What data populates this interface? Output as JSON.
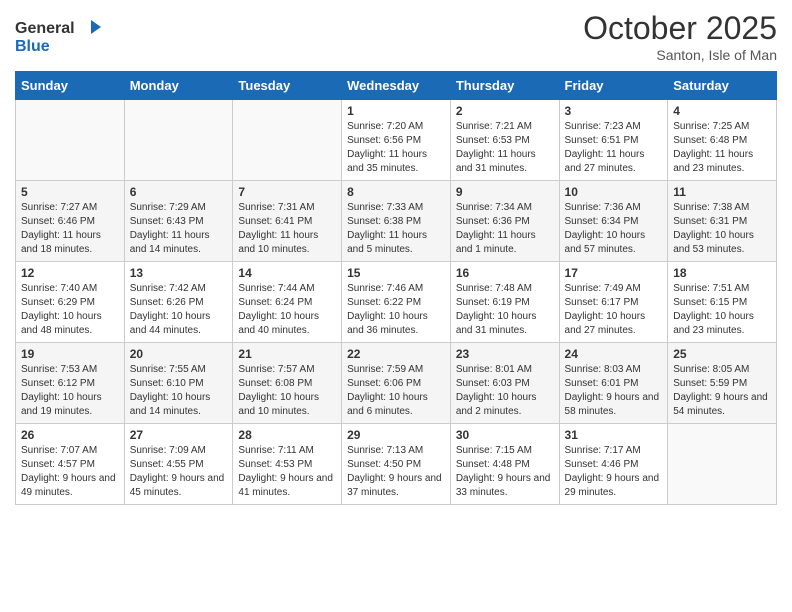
{
  "header": {
    "logo_line1": "General",
    "logo_line2": "Blue",
    "month": "October 2025",
    "location": "Santon, Isle of Man"
  },
  "days_of_week": [
    "Sunday",
    "Monday",
    "Tuesday",
    "Wednesday",
    "Thursday",
    "Friday",
    "Saturday"
  ],
  "weeks": [
    [
      {
        "day": "",
        "info": ""
      },
      {
        "day": "",
        "info": ""
      },
      {
        "day": "",
        "info": ""
      },
      {
        "day": "1",
        "info": "Sunrise: 7:20 AM\nSunset: 6:56 PM\nDaylight: 11 hours and 35 minutes."
      },
      {
        "day": "2",
        "info": "Sunrise: 7:21 AM\nSunset: 6:53 PM\nDaylight: 11 hours and 31 minutes."
      },
      {
        "day": "3",
        "info": "Sunrise: 7:23 AM\nSunset: 6:51 PM\nDaylight: 11 hours and 27 minutes."
      },
      {
        "day": "4",
        "info": "Sunrise: 7:25 AM\nSunset: 6:48 PM\nDaylight: 11 hours and 23 minutes."
      }
    ],
    [
      {
        "day": "5",
        "info": "Sunrise: 7:27 AM\nSunset: 6:46 PM\nDaylight: 11 hours and 18 minutes."
      },
      {
        "day": "6",
        "info": "Sunrise: 7:29 AM\nSunset: 6:43 PM\nDaylight: 11 hours and 14 minutes."
      },
      {
        "day": "7",
        "info": "Sunrise: 7:31 AM\nSunset: 6:41 PM\nDaylight: 11 hours and 10 minutes."
      },
      {
        "day": "8",
        "info": "Sunrise: 7:33 AM\nSunset: 6:38 PM\nDaylight: 11 hours and 5 minutes."
      },
      {
        "day": "9",
        "info": "Sunrise: 7:34 AM\nSunset: 6:36 PM\nDaylight: 11 hours and 1 minute."
      },
      {
        "day": "10",
        "info": "Sunrise: 7:36 AM\nSunset: 6:34 PM\nDaylight: 10 hours and 57 minutes."
      },
      {
        "day": "11",
        "info": "Sunrise: 7:38 AM\nSunset: 6:31 PM\nDaylight: 10 hours and 53 minutes."
      }
    ],
    [
      {
        "day": "12",
        "info": "Sunrise: 7:40 AM\nSunset: 6:29 PM\nDaylight: 10 hours and 48 minutes."
      },
      {
        "day": "13",
        "info": "Sunrise: 7:42 AM\nSunset: 6:26 PM\nDaylight: 10 hours and 44 minutes."
      },
      {
        "day": "14",
        "info": "Sunrise: 7:44 AM\nSunset: 6:24 PM\nDaylight: 10 hours and 40 minutes."
      },
      {
        "day": "15",
        "info": "Sunrise: 7:46 AM\nSunset: 6:22 PM\nDaylight: 10 hours and 36 minutes."
      },
      {
        "day": "16",
        "info": "Sunrise: 7:48 AM\nSunset: 6:19 PM\nDaylight: 10 hours and 31 minutes."
      },
      {
        "day": "17",
        "info": "Sunrise: 7:49 AM\nSunset: 6:17 PM\nDaylight: 10 hours and 27 minutes."
      },
      {
        "day": "18",
        "info": "Sunrise: 7:51 AM\nSunset: 6:15 PM\nDaylight: 10 hours and 23 minutes."
      }
    ],
    [
      {
        "day": "19",
        "info": "Sunrise: 7:53 AM\nSunset: 6:12 PM\nDaylight: 10 hours and 19 minutes."
      },
      {
        "day": "20",
        "info": "Sunrise: 7:55 AM\nSunset: 6:10 PM\nDaylight: 10 hours and 14 minutes."
      },
      {
        "day": "21",
        "info": "Sunrise: 7:57 AM\nSunset: 6:08 PM\nDaylight: 10 hours and 10 minutes."
      },
      {
        "day": "22",
        "info": "Sunrise: 7:59 AM\nSunset: 6:06 PM\nDaylight: 10 hours and 6 minutes."
      },
      {
        "day": "23",
        "info": "Sunrise: 8:01 AM\nSunset: 6:03 PM\nDaylight: 10 hours and 2 minutes."
      },
      {
        "day": "24",
        "info": "Sunrise: 8:03 AM\nSunset: 6:01 PM\nDaylight: 9 hours and 58 minutes."
      },
      {
        "day": "25",
        "info": "Sunrise: 8:05 AM\nSunset: 5:59 PM\nDaylight: 9 hours and 54 minutes."
      }
    ],
    [
      {
        "day": "26",
        "info": "Sunrise: 7:07 AM\nSunset: 4:57 PM\nDaylight: 9 hours and 49 minutes."
      },
      {
        "day": "27",
        "info": "Sunrise: 7:09 AM\nSunset: 4:55 PM\nDaylight: 9 hours and 45 minutes."
      },
      {
        "day": "28",
        "info": "Sunrise: 7:11 AM\nSunset: 4:53 PM\nDaylight: 9 hours and 41 minutes."
      },
      {
        "day": "29",
        "info": "Sunrise: 7:13 AM\nSunset: 4:50 PM\nDaylight: 9 hours and 37 minutes."
      },
      {
        "day": "30",
        "info": "Sunrise: 7:15 AM\nSunset: 4:48 PM\nDaylight: 9 hours and 33 minutes."
      },
      {
        "day": "31",
        "info": "Sunrise: 7:17 AM\nSunset: 4:46 PM\nDaylight: 9 hours and 29 minutes."
      },
      {
        "day": "",
        "info": ""
      }
    ]
  ]
}
